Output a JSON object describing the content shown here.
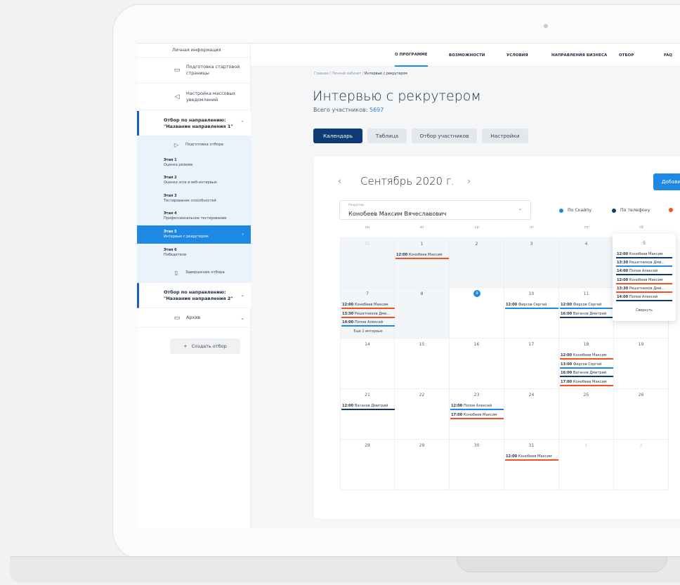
{
  "sidebar": {
    "personal_info": "Личная информация",
    "start_page": "Подготовка стартовой страницы",
    "mass_notifications": "Настройка массовых уведомлений",
    "group1_title": "Отбор по направлению: \"Название направления 1\"",
    "prep": "Подготовка отбора",
    "stages": [
      {
        "num": "Этап 1",
        "name": "Оценка резюме"
      },
      {
        "num": "Этап 2",
        "name": "Оценка эссе и веб-интервью"
      },
      {
        "num": "Этап 3",
        "name": "Тестирование способностей"
      },
      {
        "num": "Этап 4",
        "name": "Профессиональное тестирование"
      },
      {
        "num": "Этап 5",
        "name": "Интервью с рекрутером"
      },
      {
        "num": "Этап 6",
        "name": "Победители"
      }
    ],
    "finish": "Завершение отбора",
    "group2_title": "Отбор по направлению: \"Название направления 2\"",
    "archive": "Архив",
    "create": "Создать отбор"
  },
  "nav": [
    "О ПРОГРАММЕ",
    "ВОЗМОЖНОСТИ",
    "УСЛОВИЯ",
    "НАПРАВЛЕНИЯ БИЗНЕСА",
    "ОТБОР",
    "FAQ"
  ],
  "breadcrumb": [
    "Главная",
    "Личный кабинет",
    "Интервью с рекрутером"
  ],
  "page": {
    "title": "Интервью с рекрутером",
    "participants_label": "Всего участников:",
    "participants_count": "5697"
  },
  "tabs": [
    "Календарь",
    "Таблица",
    "Отбор участников",
    "Настройки"
  ],
  "calendar": {
    "month": "Сентябрь 2020 г.",
    "add_button": "Добавить",
    "recruiter_label": "Рекрутер",
    "recruiter_value": "Конобеев Максим Вячеславович",
    "legend": [
      {
        "label": "По Скайпу",
        "color": "#1e88e5"
      },
      {
        "label": "По телефону",
        "color": "#0e3b73"
      },
      {
        "label": "",
        "color": "#f4511e"
      }
    ],
    "weekdays": [
      "пн",
      "вт",
      "ср",
      "чт",
      "пт",
      "сб"
    ],
    "weeks": [
      [
        {
          "d": "31",
          "other": true,
          "shaded": true,
          "events": []
        },
        {
          "d": "1",
          "shaded": true,
          "events": [
            {
              "t": "12:00",
              "n": "Конобеев Максим",
              "k": "live"
            }
          ]
        },
        {
          "d": "2",
          "shaded": true,
          "events": []
        },
        {
          "d": "3",
          "shaded": true,
          "events": []
        },
        {
          "d": "4",
          "shaded": true,
          "events": []
        },
        {
          "d": "5",
          "events": []
        }
      ],
      [
        {
          "d": "7",
          "shaded": true,
          "events": [
            {
              "t": "12:00",
              "n": "Конобеев Максим",
              "k": "live"
            },
            {
              "t": "13:30",
              "n": "Решетников Дми...",
              "k": "live"
            },
            {
              "t": "14:00",
              "n": "Попов Алексей",
              "k": "skype"
            }
          ],
          "more": "Еще 2 интервью"
        },
        {
          "d": "8",
          "shaded": true,
          "events": []
        },
        {
          "d": "9",
          "today": true,
          "events": []
        },
        {
          "d": "10",
          "events": [
            {
              "t": "12:00",
              "n": "Фирсов Сергей",
              "k": "skype"
            }
          ]
        },
        {
          "d": "11",
          "events": [
            {
              "t": "12:00",
              "n": "Фирсов Сергей",
              "k": "skype"
            },
            {
              "t": "16:00",
              "n": "Ваганов Дмитрий",
              "k": "phone"
            }
          ]
        },
        {
          "d": "12",
          "events": []
        }
      ],
      [
        {
          "d": "14",
          "events": []
        },
        {
          "d": "15",
          "events": []
        },
        {
          "d": "16",
          "events": []
        },
        {
          "d": "17",
          "events": []
        },
        {
          "d": "18",
          "events": [
            {
              "t": "12:00",
              "n": "Конобеев Максим",
              "k": "live"
            },
            {
              "t": "13:00",
              "n": "Фирсов Сергей",
              "k": "skype"
            },
            {
              "t": "16:00",
              "n": "Ваганов Дмитрий",
              "k": "phone"
            },
            {
              "t": "17:00",
              "n": "Конобеев Максим",
              "k": "live"
            }
          ]
        },
        {
          "d": "19",
          "events": []
        }
      ],
      [
        {
          "d": "21",
          "events": [
            {
              "t": "12:00",
              "n": "Ваганов Дмитрий",
              "k": "phone"
            }
          ]
        },
        {
          "d": "22",
          "events": []
        },
        {
          "d": "23",
          "events": [
            {
              "t": "12:00",
              "n": "Попов Алексей",
              "k": "skype"
            },
            {
              "t": "17:00",
              "n": "Конобеев Максим",
              "k": "live"
            }
          ]
        },
        {
          "d": "24",
          "events": []
        },
        {
          "d": "25",
          "events": []
        },
        {
          "d": "26",
          "events": []
        }
      ],
      [
        {
          "d": "28",
          "events": []
        },
        {
          "d": "29",
          "events": []
        },
        {
          "d": "30",
          "events": []
        },
        {
          "d": "31",
          "events": [
            {
              "t": "12:00",
              "n": "Конобеев Максим",
              "k": "live"
            }
          ]
        },
        {
          "d": "1",
          "other": true,
          "events": []
        },
        {
          "d": "2",
          "other": true,
          "events": []
        }
      ]
    ],
    "popover": {
      "day": "5",
      "events": [
        {
          "t": "12:00",
          "n": "Конобеев Максим",
          "k": "phone"
        },
        {
          "t": "13:30",
          "n": "Решетников Дми...",
          "k": "skype"
        },
        {
          "t": "14:00",
          "n": "Попов Алексей",
          "k": "phone"
        },
        {
          "t": "12:00",
          "n": "Конобеев Максим",
          "k": "live"
        },
        {
          "t": "13:30",
          "n": "Решетников Дми...",
          "k": "live"
        },
        {
          "t": "14:00",
          "n": "Попов Алексей",
          "k": "phone"
        }
      ],
      "collapse": "Свернуть"
    }
  }
}
